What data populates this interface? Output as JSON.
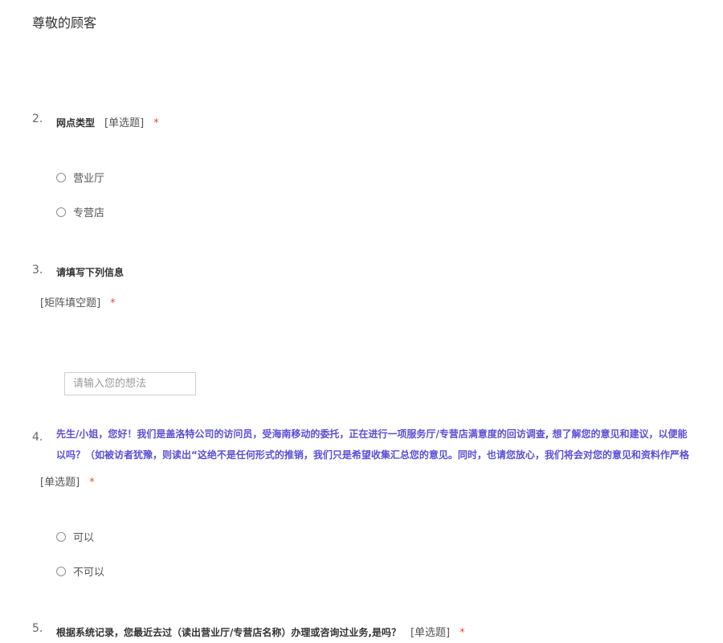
{
  "greeting": "尊敬的顾客",
  "questions": {
    "q2": {
      "num": "2.",
      "title": "网点类型",
      "type": "[单选题]",
      "required": "*",
      "options": [
        "营业厅",
        "专营店"
      ]
    },
    "q3": {
      "num": "3.",
      "title": "请填写下列信息",
      "type": "[矩阵填空题]",
      "required": "*",
      "input_placeholder": "请输入您的想法"
    },
    "q4": {
      "num": "4.",
      "title_line1": "先生/小姐，您好！我们是盖洛特公司的访问员，受海南移动的委托，正在进行一项服务厅/专营店满意度的回访调查, 想了解您的意见和建议，以便能",
      "title_line2": "以吗？（如被访者犹豫，则读出“这绝不是任何形式的推销，我们只是希望收集汇总您的意见。同时，也请您放心，我们将会对您的意见和资料作严格",
      "type": "[单选题]",
      "required": "*",
      "options": [
        "可以",
        "不可以"
      ]
    },
    "q5": {
      "num": "5.",
      "title": "根据系统记录，您最近去过（读出营业厅/专营店名称）办理或咨询过业务,是吗？",
      "type": "[单选题]",
      "required": "*"
    }
  },
  "colors": {
    "required": "#e74c3c",
    "question_purple": "#5b4fd6",
    "text": "#333333"
  }
}
